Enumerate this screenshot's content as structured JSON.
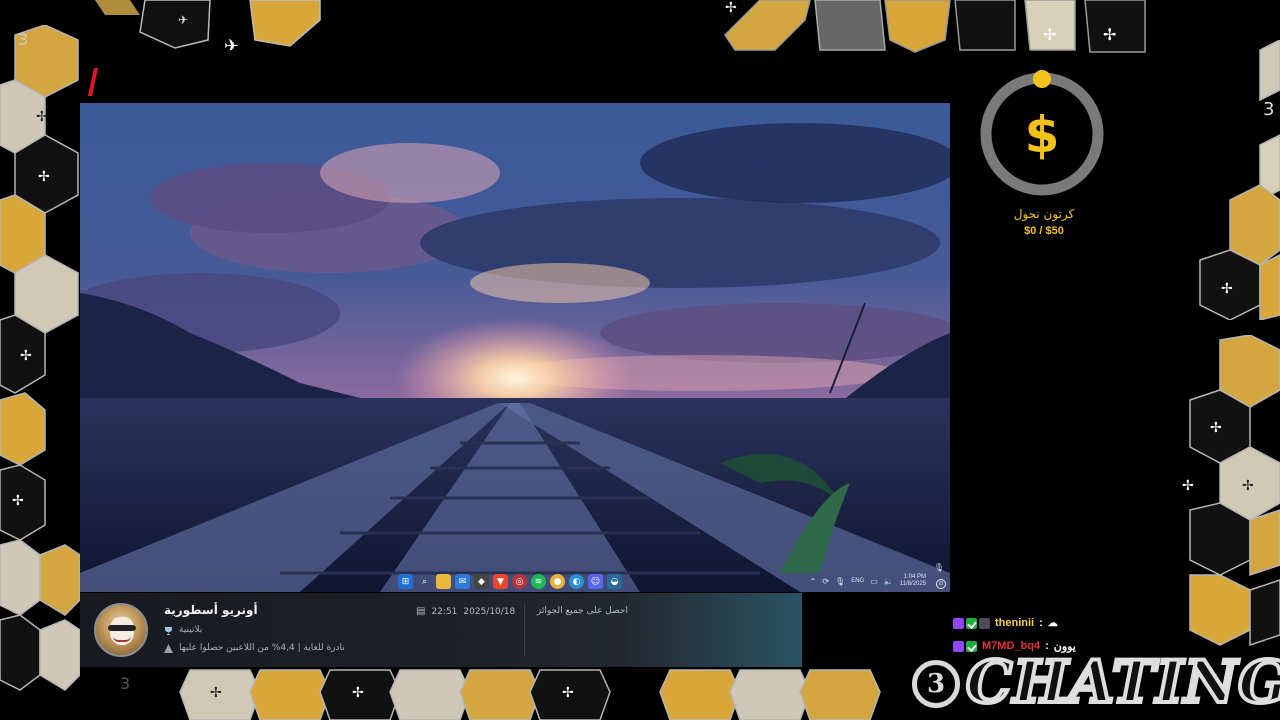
{
  "overlay": {
    "brand_text": "CHATING",
    "brand_mark": "3"
  },
  "screen": {
    "taskbar": {
      "icons": [
        "windows-start-icon",
        "search-icon",
        "file-explorer-icon",
        "mail-icon",
        "app-icon",
        "brave-icon",
        "steam-overlay-icon",
        "spotify-icon",
        "chrome-icon",
        "edge-icon",
        "discord-icon",
        "steam-icon"
      ],
      "tray_lang": "ENG",
      "clock_time": "1:04 PM",
      "clock_date": "11/8/2025"
    }
  },
  "achievement": {
    "title": "أونريو أسطورية",
    "tier": "بلاتينية",
    "rarity": "نادرة للغاية | 4,4% من اللاعبين حصلوا عليها",
    "date": "2025/10/18",
    "time": "22:51",
    "reward": "احصل على جميع الجوائز"
  },
  "goal": {
    "label": "كرتون نحول",
    "amount": "$0 / $50",
    "progress": 0,
    "color": "#f2c21a"
  },
  "chat": [
    {
      "user": "theninii",
      "separator": ":",
      "message": "",
      "user_color": "#f4d14a"
    },
    {
      "user": "M7MD_bq4",
      "separator": ":",
      "message": "يوون",
      "user_color": "#e8323a"
    }
  ]
}
